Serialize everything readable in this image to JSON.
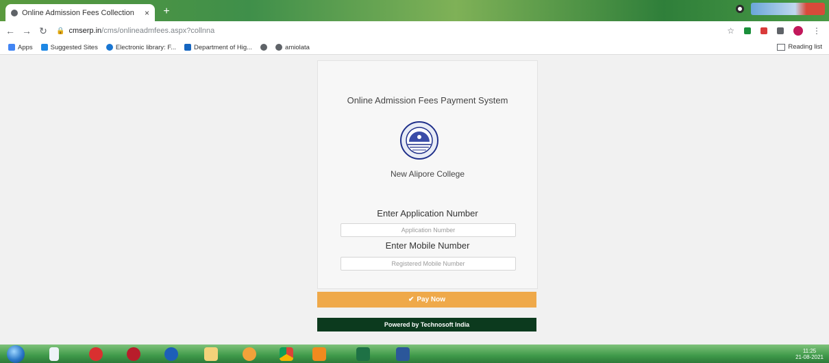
{
  "browser": {
    "tab_title": "Online Admission Fees Collection",
    "url_host": "cmserp.in",
    "url_path": "/cms/onlineadmfees.aspx?collnna",
    "bookmarks": [
      {
        "label": "Apps",
        "icon": "apps-grid-icon",
        "color": "#4285f4"
      },
      {
        "label": "Suggested Sites",
        "icon": "suggested-sites-icon",
        "color": "#1e88e5"
      },
      {
        "label": "Electronic library: F...",
        "icon": "globe-icon",
        "color": "#1976d2"
      },
      {
        "label": "Department of Hig...",
        "icon": "department-icon",
        "color": "#1565c0"
      },
      {
        "label": "",
        "icon": "globe-icon",
        "color": "#5f6368"
      },
      {
        "label": "amiolata",
        "icon": "globe-icon",
        "color": "#5f6368"
      }
    ],
    "reading_list": "Reading list"
  },
  "page": {
    "system_title": "Online Admission Fees Payment System",
    "college_name": "New Alipore College",
    "application_label": "Enter Application Number",
    "application_placeholder": "Application Number",
    "mobile_label": "Enter Mobile Number",
    "mobile_placeholder": "Registered Mobile Number",
    "pay_button": "Pay Now",
    "powered_by": "Powered by Technosoft India"
  },
  "taskbar": {
    "time": "11:25",
    "date": "21-08-2021"
  },
  "colors": {
    "pay_button": "#efa94a",
    "footer": "#0c3a1e",
    "card_bg": "#f7f7f7"
  }
}
